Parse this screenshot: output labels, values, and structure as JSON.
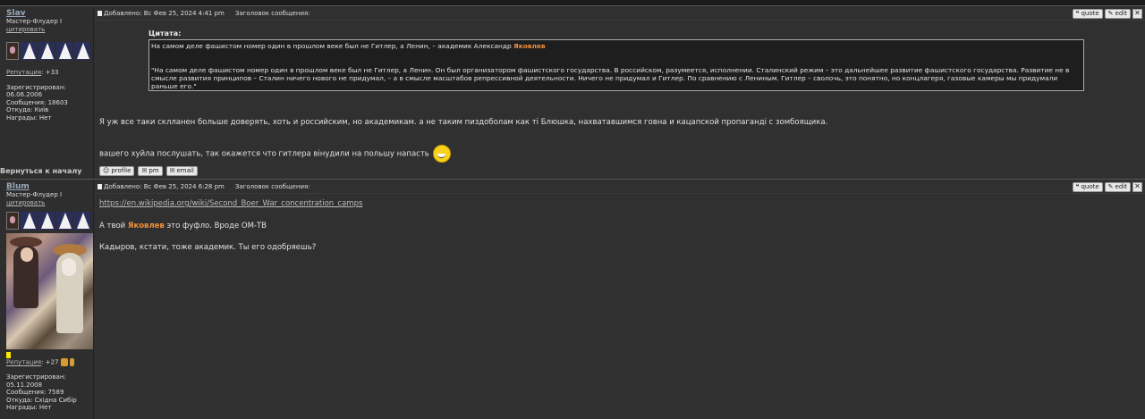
{
  "posts": [
    {
      "author": "Slav",
      "rank": "Мастер-Флудер I",
      "quote_link": "цитировать",
      "reputation_label": "Репутация",
      "reputation_value": ": +33",
      "registered_label": "Зарегистрирован:",
      "registered_value": "06.06.2006",
      "messages": "Сообщения: 18603",
      "from": "Откуда: Київ",
      "awards": "Награды: Нет",
      "header_posted": "Добавлено: Вс Фев 25, 2024 4:41 pm",
      "header_subject": "Заголовок сообщения:",
      "quote_title": "Цитата:",
      "quote_line1_pre": "На самом деле фашистом номер один в прошлом веке был не Гитлер, а Ленин, – академик Александр",
      "quote_line1_name": "Яковлев",
      "quote_para": "\"На самом деле фашистом номер один в прошлом веке был не Гитлер, а Ленин. Он был организатором фашистского государства. В российском, разумеется, исполнении. Сталинский режим – это дальнейшее развитие фашистского государства. Развитие не в смысле развития принципов – Сталин ничего нового не придумал, – а в смысле масштабов репрессивной деятельности. Ничего не придумал и Гитлер. По сравнению с Лениным. Гитлер – сволочь, это понятно, но концлагеря, газовые камеры мы придумали раньше его.\"",
      "body1": "Я уж все таки склланен больше доверять, хоть и российским, но академикам. а не таким пиздоболам как ті Блюшка, нахватавшимся говна и кацапской пропаганді с зомбоящика.",
      "body2": "вашего хуйла послушать, так окажется что гитлера вінудили на польшу напасть",
      "back_to_top": "Вернуться к началу"
    },
    {
      "author": "Blum",
      "rank": "Мастер-Флудер I",
      "quote_link": "цитировать",
      "reputation_label": "Репутация",
      "reputation_value": ": +27",
      "registered_label": "Зарегистрирован:",
      "registered_value": "05.11.2008",
      "messages": "Сообщения: 7589",
      "from": "Откуда: Східна Сибір",
      "awards": "Награды: Нет",
      "header_posted": "Добавлено: Вс Фев 25, 2024 6:28 pm",
      "header_subject": "Заголовок сообщения:",
      "url": "https://en.wikipedia.org/wiki/Second_Boer_War_concentration_camps",
      "line1_pre": "А твой",
      "line1_name": "Яковлев",
      "line1_post": "это фуфло. Вроде ОМ-ТВ",
      "line2": "Кадыров, кстати, тоже академик. Ты его одобряешь?"
    }
  ],
  "buttons": {
    "quote": "quote",
    "edit": "edit",
    "close": "✕",
    "profile": "profile",
    "pm": "pm",
    "email": "email"
  },
  "colors": {
    "highlight": "#f0903a",
    "background": "#2b2b2b"
  }
}
